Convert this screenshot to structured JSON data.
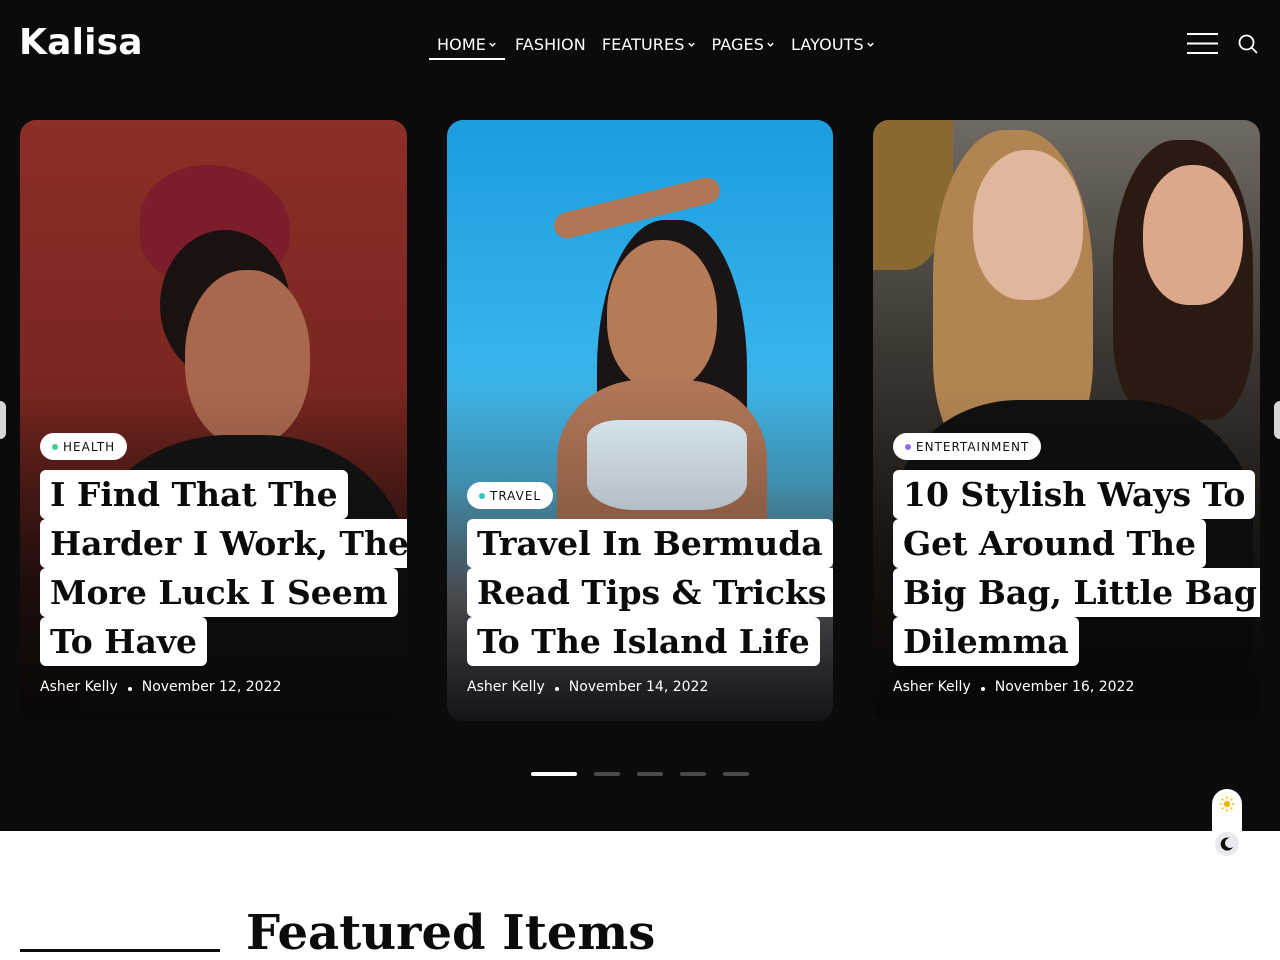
{
  "header": {
    "logo": "Kalisa",
    "nav": [
      {
        "label": "HOME",
        "has_caret": true,
        "active": true
      },
      {
        "label": "FASHION",
        "has_caret": false
      },
      {
        "label": "FEATURES",
        "has_caret": true
      },
      {
        "label": "PAGES",
        "has_caret": true
      },
      {
        "label": "LAYOUTS",
        "has_caret": true
      }
    ],
    "menu_icon": "hamburger-menu-icon",
    "search_icon": "search-icon"
  },
  "slider": {
    "cards": [
      {
        "category": "HEALTH",
        "category_dot_color": "#3ecf8e",
        "title_lines": [
          "I Find That The",
          "Harder I Work, The",
          "More Luck I Seem",
          "To Have"
        ],
        "author": "Asher Kelly",
        "date": "November 12, 2022"
      },
      {
        "category": "TRAVEL",
        "category_dot_color": "#2dc6c2",
        "title_lines": [
          "Travel In Bermuda",
          "Read Tips & Tricks",
          "To The Island Life"
        ],
        "author": "Asher Kelly",
        "date": "November 14, 2022"
      },
      {
        "category": "ENTERTAINMENT",
        "category_dot_color": "#8a6cf0",
        "title_lines": [
          "10 Stylish Ways To",
          "Get Around The",
          "Big Bag, Little Bag",
          "Dilemma"
        ],
        "author": "Asher Kelly",
        "date": "November 16, 2022"
      }
    ],
    "pagination": {
      "total": 5,
      "current": 1
    }
  },
  "theme_toggle": {
    "light_icon": "sun-icon",
    "dark_icon": "moon-icon",
    "sun_color": "#f5b800"
  },
  "featured": {
    "title": "Featured Items"
  }
}
